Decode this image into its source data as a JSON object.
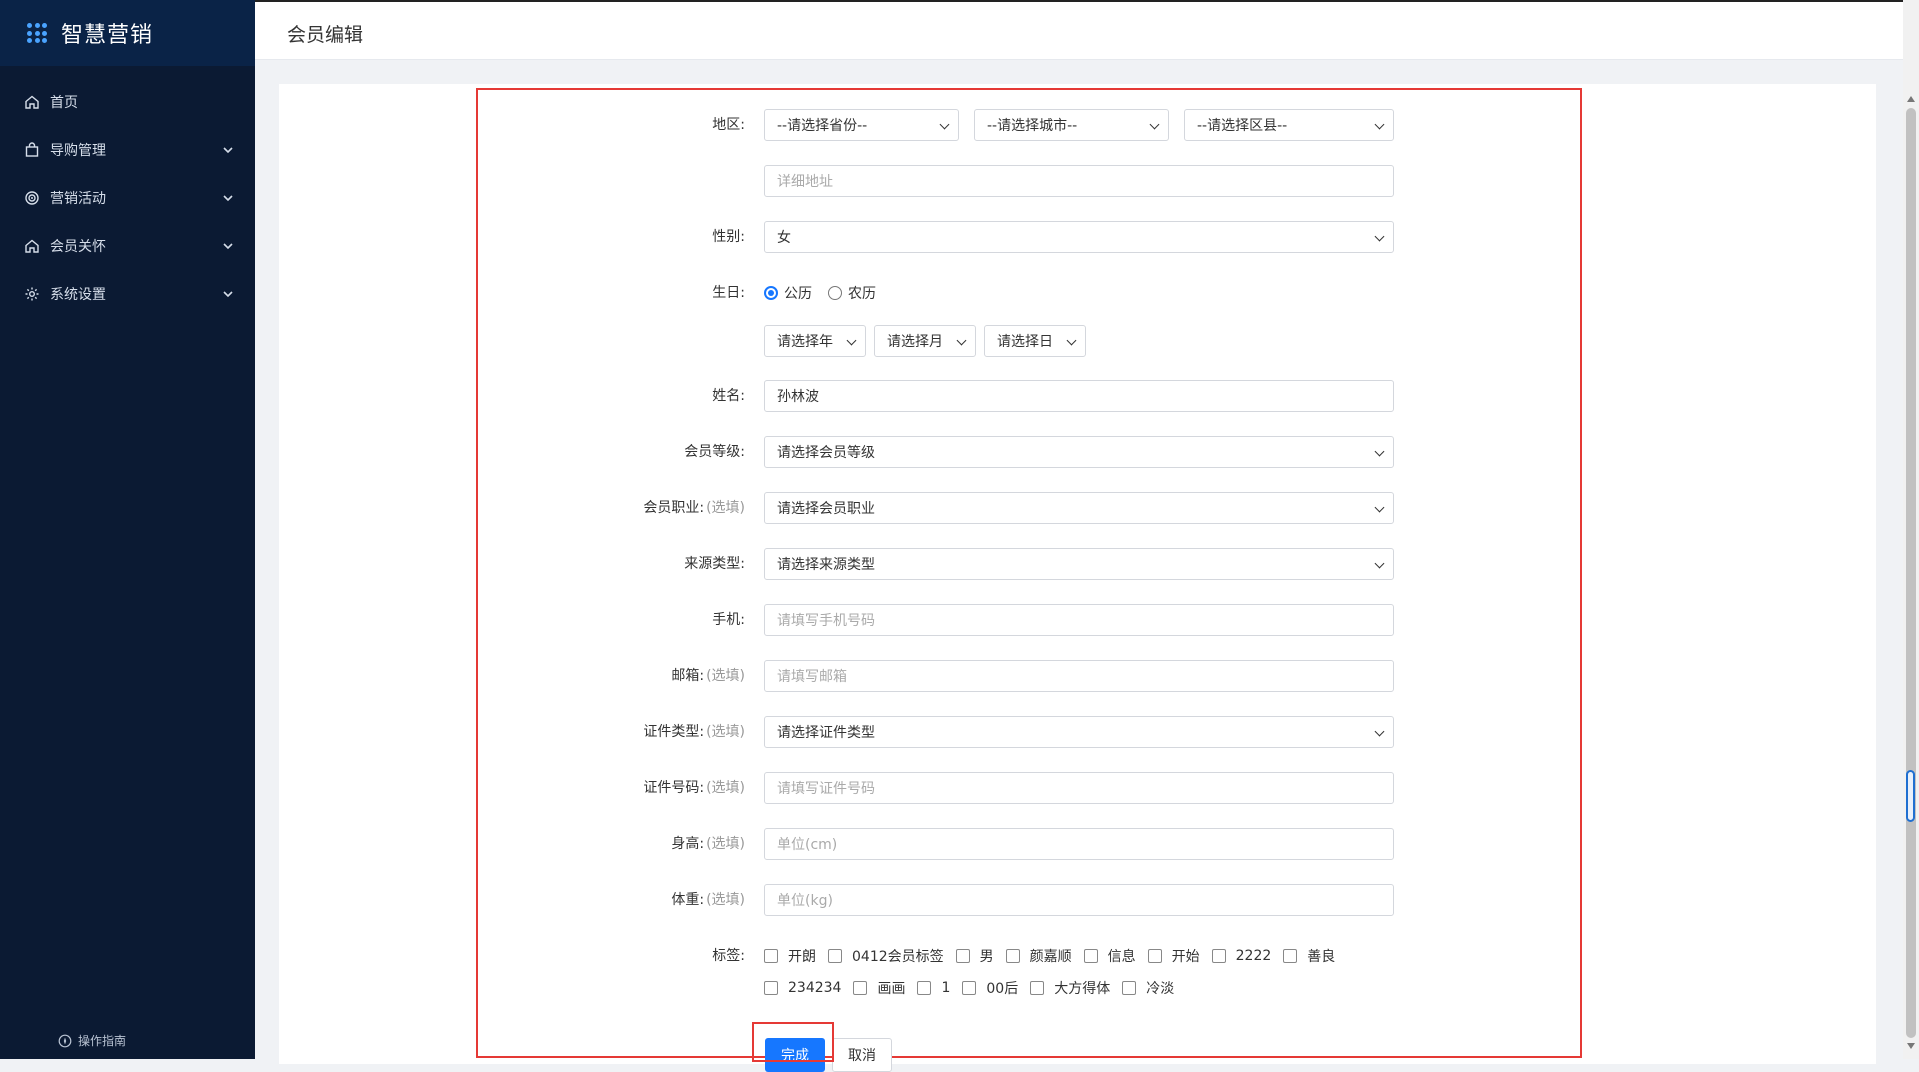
{
  "app": {
    "brand": "智慧营销",
    "page_title": "会员编辑",
    "footer_link": "操作指南"
  },
  "sidebar": {
    "items": [
      {
        "label": "首页",
        "icon": "home-icon",
        "expandable": false
      },
      {
        "label": "导购管理",
        "icon": "bag-icon",
        "expandable": true
      },
      {
        "label": "营销活动",
        "icon": "target-icon",
        "expandable": true
      },
      {
        "label": "会员关怀",
        "icon": "home-icon",
        "expandable": true
      },
      {
        "label": "系统设置",
        "icon": "gear-icon",
        "expandable": true
      }
    ]
  },
  "form": {
    "region": {
      "label": "地区:",
      "province": "--请选择省份--",
      "city": "--请选择城市--",
      "district": "--请选择区县--",
      "address_placeholder": "详细地址"
    },
    "gender": {
      "label": "性别:",
      "value": "女"
    },
    "birthday": {
      "label": "生日:",
      "options": [
        "公历",
        "农历"
      ],
      "selected": "公历",
      "year": "请选择年",
      "month": "请选择月",
      "day": "请选择日"
    },
    "name": {
      "label": "姓名:",
      "value": "孙林波"
    },
    "level": {
      "label": "会员等级:",
      "value": "请选择会员等级"
    },
    "occupation": {
      "label": "会员职业:",
      "optional": "(选填)",
      "value": "请选择会员职业"
    },
    "source": {
      "label": "来源类型:",
      "value": "请选择来源类型"
    },
    "phone": {
      "label": "手机:",
      "placeholder": "请填写手机号码"
    },
    "email": {
      "label": "邮箱:",
      "optional": "(选填)",
      "placeholder": "请填写邮箱"
    },
    "id_type": {
      "label": "证件类型:",
      "optional": "(选填)",
      "value": "请选择证件类型"
    },
    "id_number": {
      "label": "证件号码:",
      "optional": "(选填)",
      "placeholder": "请填写证件号码"
    },
    "height": {
      "label": "身高:",
      "optional": "(选填)",
      "placeholder": "单位(cm)"
    },
    "weight": {
      "label": "体重:",
      "optional": "(选填)",
      "placeholder": "单位(kg)"
    },
    "tags": {
      "label": "标签:",
      "line1": [
        "开朗",
        "0412会员标签",
        "男",
        "颜嘉顺",
        "信息",
        "开始",
        "2222",
        "善良"
      ],
      "line2": [
        "234234",
        "画画",
        "1",
        "00后",
        "大方得体",
        "冷淡"
      ]
    },
    "buttons": {
      "submit": "完成",
      "cancel": "取消"
    }
  },
  "colors": {
    "sidebar_bg": "#0b1a33",
    "primary": "#1677ff",
    "highlight": "#e53935"
  }
}
